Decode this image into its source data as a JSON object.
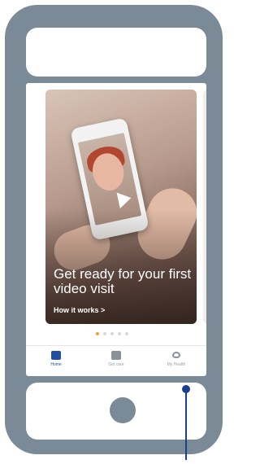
{
  "card": {
    "title": "Get ready for your first video visit",
    "link": "How it works >"
  },
  "carousel": {
    "page_count": 5,
    "active_index": 0
  },
  "tabbar": {
    "tabs": [
      {
        "label": "Home",
        "icon": "home-icon",
        "active": true
      },
      {
        "label": "Get care",
        "icon": "medical-bag-icon",
        "active": false
      },
      {
        "label": "My Health",
        "icon": "heart-icon",
        "active": false
      }
    ]
  },
  "colors": {
    "device_frame": "#7a8a96",
    "accent": "#1f4ea3",
    "callout": "#1a3f8f",
    "active_dot": "#f0a23a"
  }
}
